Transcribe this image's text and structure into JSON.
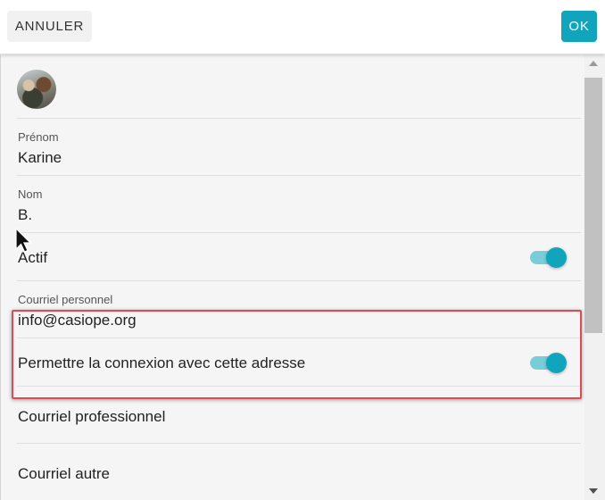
{
  "header": {
    "cancel_label": "ANNULER",
    "ok_label": "OK"
  },
  "form": {
    "first_name": {
      "label": "Prénom",
      "value": "Karine"
    },
    "last_name": {
      "label": "Nom",
      "value": "B."
    },
    "active": {
      "label": "Actif",
      "checked": true
    },
    "personal_email": {
      "label": "Courriel personnel",
      "value": "info@casiope.org",
      "allow_login": {
        "label": "Permettre la connexion avec cette adresse",
        "checked": true
      }
    },
    "professional_email": {
      "label": "Courriel professionnel"
    },
    "other_email": {
      "label": "Courriel autre"
    }
  },
  "colors": {
    "accent": "#10a5bd",
    "toggle_track": "#78cdd8",
    "highlight_border": "#e04a50"
  }
}
